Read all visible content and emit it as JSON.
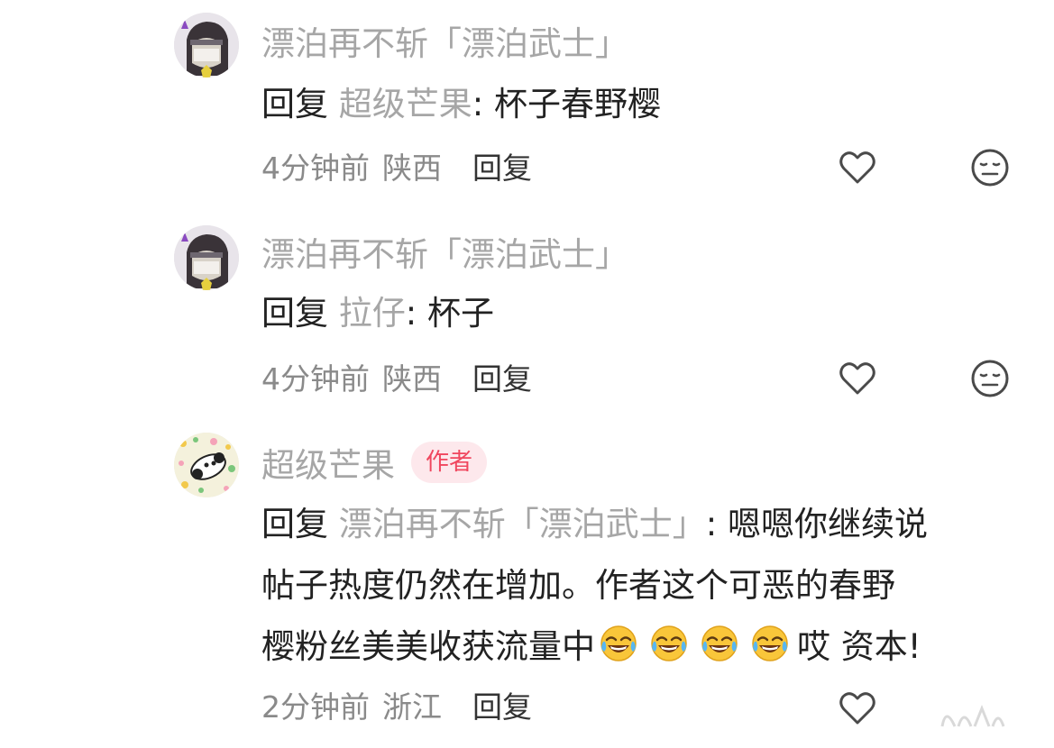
{
  "comments": [
    {
      "author": "漂泊再不斩「漂泊武士」",
      "badge": "",
      "reply_word": "回复",
      "reply_target": "超级芒果",
      "separator": ": ",
      "text": "杯子春野樱",
      "time": "4分钟前",
      "location": "陕西",
      "reply_label": "回复",
      "avatar": "masked-ninja-avatar"
    },
    {
      "author": "漂泊再不斩「漂泊武士」",
      "badge": "",
      "reply_word": "回复",
      "reply_target": "拉仔",
      "separator": ": ",
      "text": "杯子",
      "time": "4分钟前",
      "location": "陕西",
      "reply_label": "回复",
      "avatar": "masked-ninja-avatar"
    },
    {
      "author": "超级芒果",
      "badge": "作者",
      "reply_word": "回复",
      "reply_target": "漂泊再不斩「漂泊武士」",
      "separator": ": ",
      "text_line1": "嗯嗯你继续说",
      "text_line2": "帖子热度仍然在增加。作者这个可恶的春野",
      "text_line3_a": "樱粉丝美美收获流量中",
      "emoji": "face-with-tears-of-joy",
      "emoji_count": 4,
      "text_line3_b": "哎 资本!",
      "time": "2分钟前",
      "location": "浙江",
      "reply_label": "回复",
      "avatar": "floral-panda-avatar"
    }
  ],
  "icons": {
    "like": "heart-outline-icon",
    "dislike": "neutral-face-icon"
  },
  "colors": {
    "author": "#a6a6a6",
    "body": "#222222",
    "meta": "#8a8a8a",
    "badge_bg": "#fde8ec",
    "badge_text": "#f0465e"
  }
}
